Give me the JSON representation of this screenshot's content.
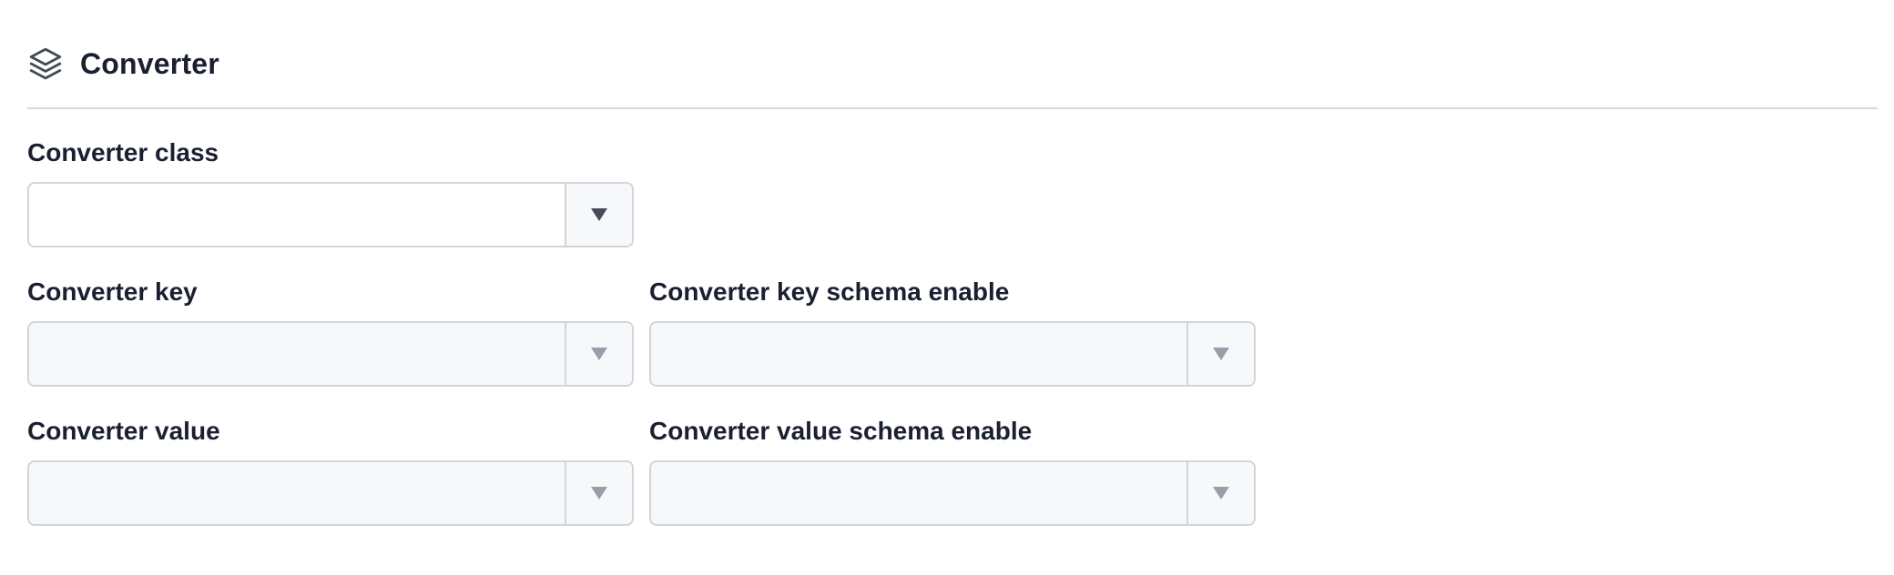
{
  "section": {
    "title": "Converter",
    "icon": "layers-icon"
  },
  "fields": {
    "converter_class": {
      "label": "Converter class",
      "value": ""
    },
    "converter_key": {
      "label": "Converter key",
      "value": ""
    },
    "converter_key_schema_enable": {
      "label": "Converter key schema enable",
      "value": ""
    },
    "converter_value": {
      "label": "Converter value",
      "value": ""
    },
    "converter_value_schema_enable": {
      "label": "Converter value schema enable",
      "value": ""
    }
  },
  "colors": {
    "text": "#1b2030",
    "border": "#d1d5db",
    "disabled_bg": "#f7f8fa",
    "caret_active": "#454b57",
    "caret_disabled": "#9a9ea8"
  }
}
